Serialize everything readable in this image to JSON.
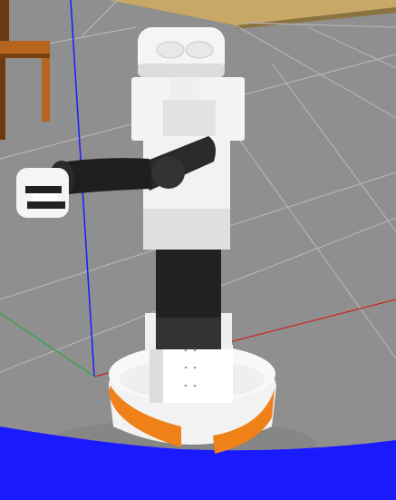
{
  "scene": {
    "colors": {
      "floor": "#8f8f8f",
      "floor_far": "#9c9c9c",
      "grid_line": "#b8b8b8",
      "wall": "#c8a866",
      "axis_blue": "#1a1aff",
      "axis_red": "#cc2222",
      "axis_green": "#22aa44",
      "robot_white": "#f2f2f2",
      "robot_shadow": "#cfcfcf",
      "robot_black": "#222222",
      "base_orange": "#f08018",
      "chair_wood": "#b5651d",
      "blue_region": "#1a1aff"
    },
    "objects": [
      {
        "name": "robot",
        "icon": "robot-icon"
      },
      {
        "name": "chair",
        "icon": "chair-icon"
      }
    ]
  }
}
